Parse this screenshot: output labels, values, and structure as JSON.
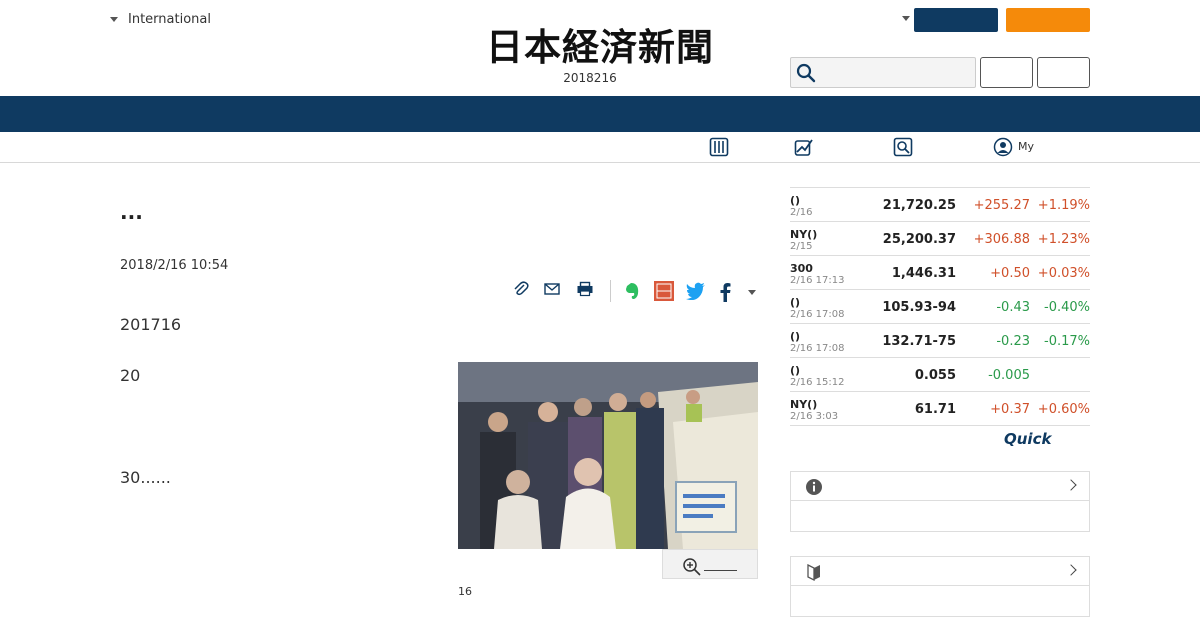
{
  "header": {
    "edition": "International",
    "logo": "日本経済新聞",
    "date": "2018216",
    "search_placeholder": ""
  },
  "subnav": {
    "my_label": "My"
  },
  "article": {
    "headline": "...",
    "timestamp": "2018/2/16 10:54",
    "paragraphs": [
      "201716",
      "20",
      "30......"
    ],
    "caption": "16"
  },
  "market": {
    "rows": [
      {
        "name": "()",
        "time": "2/16",
        "value": "21,720.25",
        "change": "+255.27",
        "pct": "+1.19%"
      },
      {
        "name": "NY()",
        "time": "2/15",
        "value": "25,200.37",
        "change": "+306.88",
        "pct": "+1.23%"
      },
      {
        "name": "300",
        "time": "2/16 17:13",
        "value": "1,446.31",
        "change": "+0.50",
        "pct": "+0.03%"
      },
      {
        "name": "()",
        "time": "2/16 17:08",
        "value": "105.93-94",
        "change": "-0.43",
        "pct": "-0.40%"
      },
      {
        "name": "()",
        "time": "2/16 17:08",
        "value": "132.71-75",
        "change": "-0.23",
        "pct": "-0.17%"
      },
      {
        "name": "()",
        "time": "2/16 15:12",
        "value": "0.055",
        "change": "-0.005",
        "pct": ""
      },
      {
        "name": "NY()",
        "time": "2/16 3:03",
        "value": "61.71",
        "change": "+0.37",
        "pct": "+0.60%"
      }
    ],
    "provider": "Quick"
  },
  "colors": {
    "navy": "#0f3a61",
    "orange": "#f58a0a",
    "up": "#d0502a",
    "down": "#2a9a4a"
  }
}
